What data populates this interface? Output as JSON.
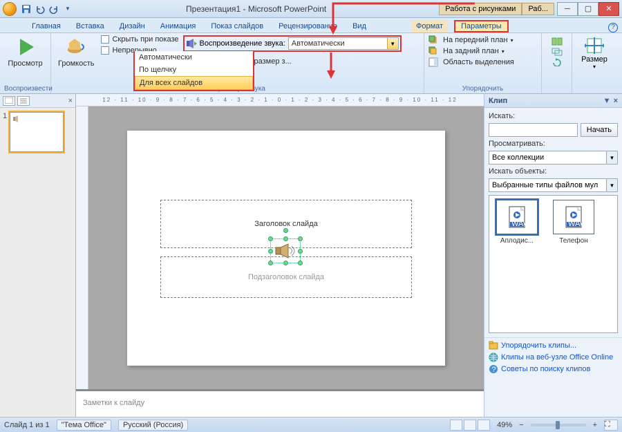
{
  "title": "Презентация1 - Microsoft PowerPoint",
  "context_tabs": {
    "tools": "Работа с рисунками",
    "extra": "Раб..."
  },
  "tabs": {
    "home": "Главная",
    "insert": "Вставка",
    "design": "Дизайн",
    "anim": "Анимация",
    "show": "Показ слайдов",
    "review": "Рецензирование",
    "view": "Вид",
    "format": "Формат",
    "params": "Параметры"
  },
  "ribbon": {
    "preview": {
      "label": "Просмотр",
      "group": "Воспроизвести"
    },
    "volume": {
      "label": "Громкость"
    },
    "hide": "Скрыть при показе",
    "loop": "Непрерывно",
    "play_label": "Воспроизведение звука:",
    "play_value": "Автоматически",
    "maxsize": "Максимальный размер з...",
    "sound_group": "Параметры звука",
    "dd": {
      "auto": "Автоматически",
      "click": "По щелчку",
      "all": "Для всех слайдов"
    },
    "arrange": {
      "front": "На передний план",
      "back": "На задний план",
      "selpane": "Область выделения",
      "group": "Упорядочить"
    },
    "size": {
      "label": "Размер",
      "group": "..."
    }
  },
  "slide": {
    "title_ph": "Заголовок слайда",
    "sub_ph": "Подзаголовок слайда"
  },
  "notes": "Заметки к слайду",
  "clip": {
    "header": "Клип",
    "search_label": "Искать:",
    "go": "Начать",
    "look_label": "Просматривать:",
    "look_value": "Все коллекции",
    "obj_label": "Искать объекты:",
    "obj_value": "Выбранные типы файлов мул",
    "item1": "Аплодис...",
    "item2": "Телефон",
    "link1": "Упорядочить клипы...",
    "link2": "Клипы на веб-узле Office Online",
    "link3": "Советы по поиску клипов"
  },
  "status": {
    "slide": "Слайд 1 из 1",
    "theme": "\"Тема Office\"",
    "lang": "Русский (Россия)",
    "zoom": "49%"
  },
  "ruler": "12 · 11 · 10 · 9 · 8 · 7 · 6 · 5 · 4 · 3 · 2 · 1 · 0 · 1 · 2 · 3 · 4 · 5 · 6 · 7 · 8 · 9 · 10 · 11 · 12"
}
